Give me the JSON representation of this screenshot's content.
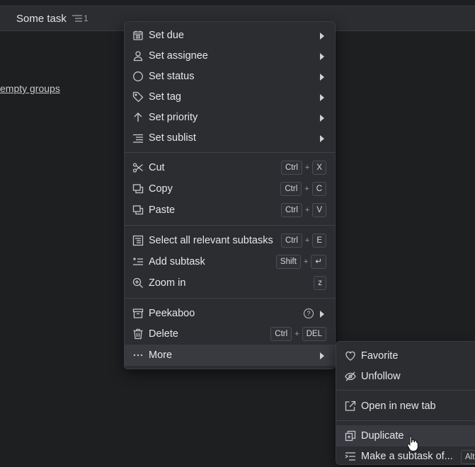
{
  "header": {
    "task_title": "Some task",
    "subtask_count": "1"
  },
  "main": {
    "empty_groups_link": "empty groups"
  },
  "context_menu": {
    "items": [
      {
        "label": "Set due",
        "icon": "calendar-icon"
      },
      {
        "label": "Set assignee",
        "icon": "person-icon"
      },
      {
        "label": "Set status",
        "icon": "circle-icon"
      },
      {
        "label": "Set tag",
        "icon": "tag-icon"
      },
      {
        "label": "Set priority",
        "icon": "arrow-up-icon"
      },
      {
        "label": "Set sublist",
        "icon": "sublist-icon"
      },
      {
        "label": "Cut",
        "icon": "scissors-icon",
        "keys": [
          "Ctrl",
          "X"
        ]
      },
      {
        "label": "Copy",
        "icon": "copy-icon",
        "keys": [
          "Ctrl",
          "C"
        ]
      },
      {
        "label": "Paste",
        "icon": "paste-icon",
        "keys": [
          "Ctrl",
          "V"
        ]
      },
      {
        "label": "Select all relevant subtasks",
        "icon": "select-all-icon",
        "keys": [
          "Ctrl",
          "E"
        ]
      },
      {
        "label": "Add subtask",
        "icon": "add-subtask-icon",
        "keys": [
          "Shift",
          "↵"
        ]
      },
      {
        "label": "Zoom in",
        "icon": "zoom-in-icon",
        "keys": [
          "z"
        ]
      },
      {
        "label": "Peekaboo",
        "icon": "archive-icon",
        "help": "?"
      },
      {
        "label": "Delete",
        "icon": "trash-icon",
        "keys": [
          "Ctrl",
          "DEL"
        ]
      },
      {
        "label": "More",
        "icon": "ellipsis-icon"
      }
    ],
    "plus": "+"
  },
  "submenu": {
    "items": [
      {
        "label": "Favorite",
        "icon": "heart-icon"
      },
      {
        "label": "Unfollow",
        "icon": "eye-off-icon"
      },
      {
        "label": "Open in new tab",
        "icon": "external-link-icon"
      },
      {
        "label": "Duplicate",
        "icon": "duplicate-icon"
      },
      {
        "label": "Make a subtask of...",
        "icon": "make-subtask-icon",
        "partial_key": "Alt"
      }
    ]
  },
  "colors": {
    "background": "#1e1f21",
    "menu": "#2b2d31",
    "hover": "#383a40",
    "text": "#e6e7e9"
  }
}
